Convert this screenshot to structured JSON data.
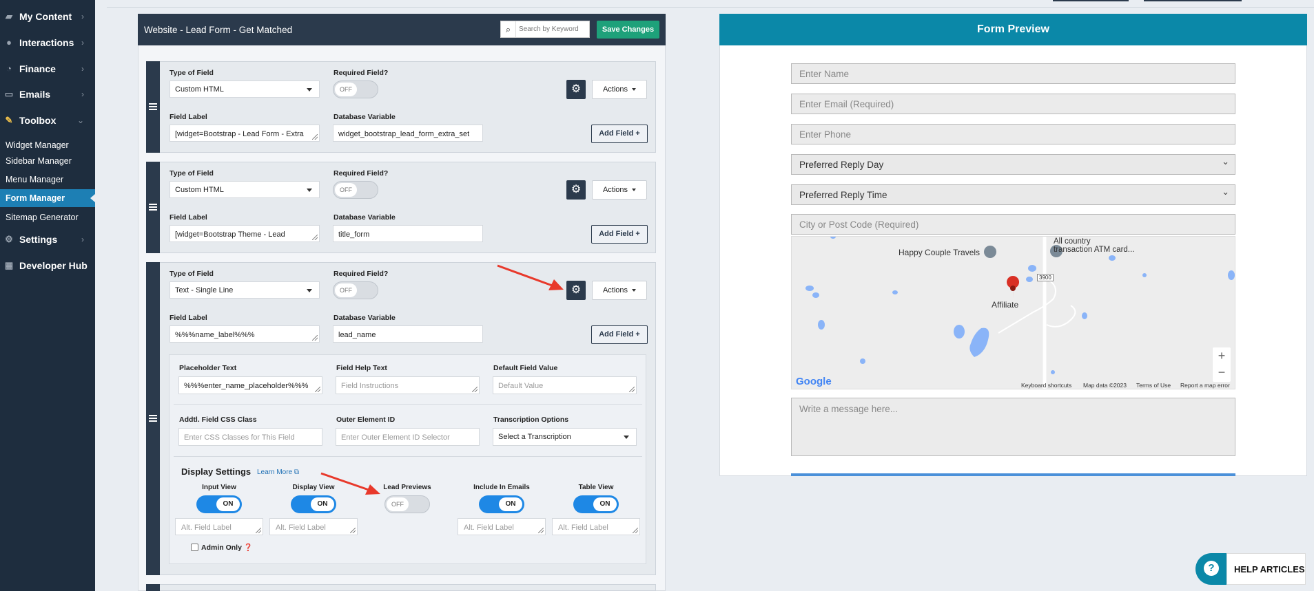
{
  "sidebar": {
    "items": [
      {
        "label": "My Content",
        "icon": "folder-icon"
      },
      {
        "label": "Interactions",
        "icon": "chat-icon"
      },
      {
        "label": "Finance",
        "icon": "chart-icon"
      },
      {
        "label": "Emails",
        "icon": "inbox-icon"
      },
      {
        "label": "Toolbox",
        "icon": "wrench-icon"
      }
    ],
    "toolbox_items": [
      "Widget Manager",
      "Sidebar Manager",
      "Menu Manager",
      "Form Manager",
      "Sitemap Generator"
    ],
    "bottom_items": [
      {
        "label": "Settings",
        "icon": "gear-icon"
      },
      {
        "label": "Developer Hub",
        "icon": "grid-icon"
      }
    ]
  },
  "editor": {
    "title": "Website - Lead Form - Get Matched",
    "search_placeholder": "Search by Keyword",
    "save_label": "Save Changes",
    "labels": {
      "type": "Type of Field",
      "required": "Required Field?",
      "field_label": "Field Label",
      "db_var": "Database Variable",
      "actions": "Actions",
      "add_field": "Add Field +",
      "off": "OFF",
      "on": "ON"
    },
    "fields": [
      {
        "type": "Custom HTML",
        "field_label": "[widget=Bootstrap - Lead Form - Extra",
        "db_var": "widget_bootstrap_lead_form_extra_set"
      },
      {
        "type": "Custom HTML",
        "field_label": "[widget=Bootstrap Theme - Lead",
        "db_var": "title_form"
      },
      {
        "type": "Text - Single Line",
        "field_label": "%%%name_label%%%",
        "db_var": "lead_name"
      }
    ],
    "advanced": {
      "placeholder_text_label": "Placeholder Text",
      "placeholder_text_value": "%%%enter_name_placeholder%%%",
      "help_text_label": "Field Help Text",
      "help_text_placeholder": "Field Instructions",
      "default_label": "Default Field Value",
      "default_placeholder": "Default Value",
      "css_label": "Addtl. Field CSS Class",
      "css_placeholder": "Enter CSS Classes for This Field",
      "outer_label": "Outer Element ID",
      "outer_placeholder": "Enter Outer Element ID Selector",
      "transcription_label": "Transcription Options",
      "transcription_value": "Select a Transcription"
    },
    "display": {
      "title": "Display Settings",
      "learn_more": "Learn More",
      "toggles": [
        {
          "label": "Input View",
          "state": "ON"
        },
        {
          "label": "Display View",
          "state": "ON"
        },
        {
          "label": "Lead Previews",
          "state": "OFF"
        },
        {
          "label": "Include In Emails",
          "state": "ON"
        },
        {
          "label": "Table View",
          "state": "ON"
        }
      ],
      "alt_placeholder": "Alt. Field Label",
      "admin_only": "Admin Only"
    }
  },
  "preview": {
    "title": "Form Preview",
    "fields": [
      "Enter Name",
      "Enter Email (Required)",
      "Enter Phone",
      "Preferred Reply Day",
      "Preferred Reply Time",
      "City or Post Code (Required)"
    ],
    "map": {
      "places": [
        "Happy Couple Travels",
        "All country",
        "transaction ATM card...",
        "Affiliate",
        "3900"
      ],
      "footer": [
        "Keyboard shortcuts",
        "Map data ©2023",
        "Terms of Use",
        "Report a map error"
      ],
      "logo": "Google",
      "zoom_in": "+",
      "zoom_out": "−"
    },
    "message_placeholder": "Write a message here..."
  },
  "help": {
    "label": "HELP ARTICLES"
  },
  "colors": {
    "sidebar": "#1e2d3e",
    "header": "#2b3a4c",
    "active": "#1d7fb4",
    "save": "#1ea17a",
    "preview": "#0b88a8",
    "toggle_on": "#1e88e5",
    "arrow": "#e8392b"
  }
}
